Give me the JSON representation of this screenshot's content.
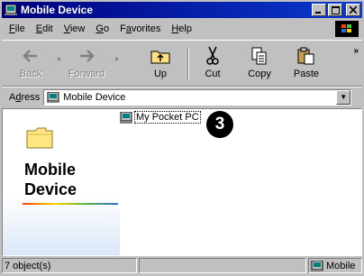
{
  "window": {
    "title": "Mobile Device",
    "controls": [
      "minimize",
      "maximize",
      "close"
    ]
  },
  "menubar": {
    "items": [
      {
        "key": "F",
        "rest": "ile"
      },
      {
        "key": "E",
        "rest": "dit"
      },
      {
        "key": "V",
        "rest": "iew"
      },
      {
        "key": "G",
        "rest": "o"
      },
      {
        "key": "a",
        "pre": "F",
        "rest": "vorites"
      },
      {
        "key": "H",
        "rest": "elp"
      }
    ]
  },
  "toolbar": {
    "back": "Back",
    "forward": "Forward",
    "up": "Up",
    "cut": "Cut",
    "copy": "Copy",
    "paste": "Paste",
    "more": "»"
  },
  "address": {
    "label_key": "d",
    "label_pre": "A",
    "label_rest": "ress",
    "value": "Mobile Device"
  },
  "content": {
    "pane_title_line1": "Mobile",
    "pane_title_line2": "Device",
    "items": [
      {
        "label": "My Pocket PC",
        "icon": "pocket-pc-icon"
      }
    ],
    "callout": "3"
  },
  "statusbar": {
    "count": "7 object(s)",
    "location": "Mobile"
  },
  "colors": {
    "titlebar_start": "#00007b",
    "titlebar_end": "#0a3ad0",
    "chrome": "#c0c0c0"
  }
}
